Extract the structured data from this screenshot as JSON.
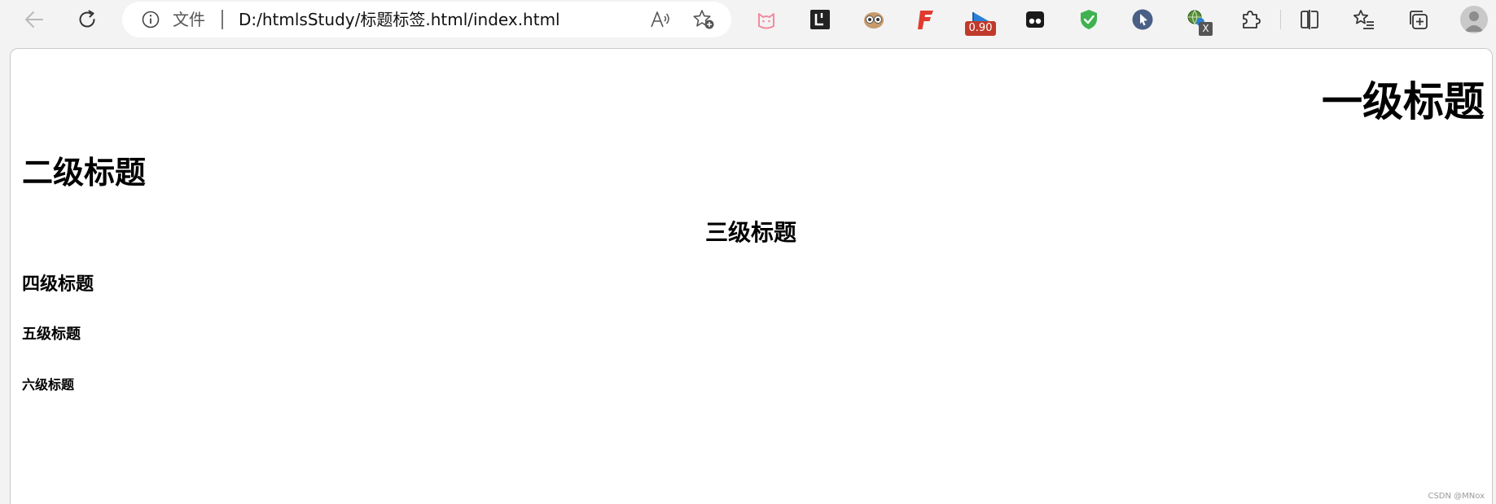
{
  "toolbar": {
    "back_icon": "arrow-left-icon",
    "refresh_icon": "refresh-icon",
    "address": {
      "scheme_label": "文件",
      "url": "D:/htmlsStudy/标题标签.html/index.html",
      "info_icon": "info-circle-icon",
      "read_aloud_icon": "read-aloud-icon",
      "favorite_add_icon": "star-plus-icon"
    },
    "extensions": [
      {
        "name": "cat-face-icon",
        "color": "#f28aa0"
      },
      {
        "name": "leetcode-icon",
        "color": "#222222"
      },
      {
        "name": "owl-icon",
        "color": "#c79a6b"
      },
      {
        "name": "flash-f-icon",
        "color": "#e23a2f"
      },
      {
        "name": "speed-flag-icon",
        "color": "#2a7fd6",
        "badge": "0.90"
      },
      {
        "name": "dark-glasses-icon",
        "color": "#1a1a1a"
      },
      {
        "name": "shield-check-icon",
        "color": "#3fb24f"
      },
      {
        "name": "cursor-icon",
        "color": "#4a5f86"
      },
      {
        "name": "network-globe-icon",
        "color": "#5a8f3c",
        "badge": "X"
      },
      {
        "name": "puzzle-icon",
        "color": "#333333"
      }
    ],
    "split_screen_icon": "split-screen-icon",
    "favorites_icon": "favorites-list-icon",
    "collections_icon": "collections-icon",
    "profile_icon": "profile-avatar-icon"
  },
  "page": {
    "h1": "一级标题",
    "h2": "二级标题",
    "h3": "三级标题",
    "h4": "四级标题",
    "h5": "五级标题",
    "h6": "六级标题"
  },
  "watermark": "CSDN @MNox"
}
